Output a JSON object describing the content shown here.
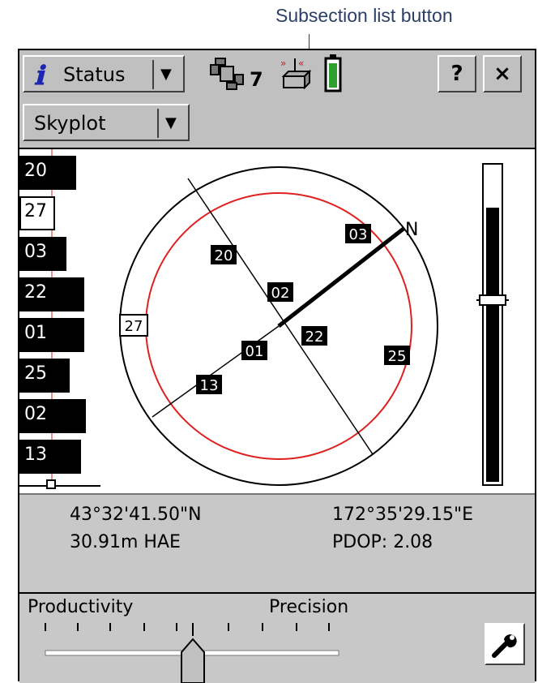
{
  "callout": {
    "text": "Subsection list button"
  },
  "header": {
    "app_button_label": "Status",
    "satellites_in_use": "7",
    "help_label": "?",
    "close_label": "×"
  },
  "subsection": {
    "label": "Skyplot"
  },
  "sat_list": [
    {
      "id": "20",
      "style": "filled"
    },
    {
      "id": "27",
      "style": "outline"
    },
    {
      "id": "03",
      "style": "filled"
    },
    {
      "id": "22",
      "style": "filled"
    },
    {
      "id": "01",
      "style": "filled"
    },
    {
      "id": "25",
      "style": "filled"
    },
    {
      "id": "02",
      "style": "filled"
    },
    {
      "id": "13",
      "style": "filled"
    }
  ],
  "skyplot": {
    "north_label": "N",
    "satellites": [
      {
        "id": "03",
        "style": "filled"
      },
      {
        "id": "20",
        "style": "filled"
      },
      {
        "id": "02",
        "style": "filled"
      },
      {
        "id": "27",
        "style": "outline"
      },
      {
        "id": "22",
        "style": "filled"
      },
      {
        "id": "01",
        "style": "filled"
      },
      {
        "id": "25",
        "style": "filled"
      },
      {
        "id": "13",
        "style": "filled"
      }
    ]
  },
  "position": {
    "latitude": "43°32'41.50\"N",
    "longitude": "172°35'29.15\"E",
    "height": "30.91m HAE",
    "pdop": "PDOP: 2.08"
  },
  "productivity_slider": {
    "left_label": "Productivity",
    "right_label": "Precision"
  },
  "colors": {
    "mask_circle": "#e02020",
    "icon_accent": "#1c26b0",
    "battery": "#2fa030"
  }
}
